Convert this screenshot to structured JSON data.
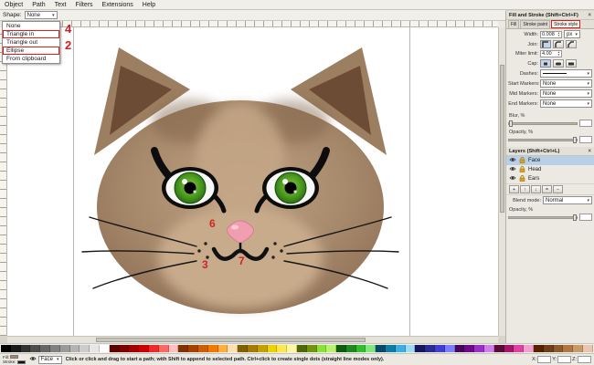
{
  "menu": {
    "items": [
      "Object",
      "Path",
      "Text",
      "Filters",
      "Extensions",
      "Help"
    ]
  },
  "toolbar": {
    "shape_label": "Shape:",
    "shape_value": "None"
  },
  "shape_menu": {
    "items": [
      {
        "label": "None",
        "boxed": false,
        "annotation": ""
      },
      {
        "label": "Triangle in",
        "boxed": true,
        "annotation": "4"
      },
      {
        "label": "Triangle out",
        "boxed": false,
        "annotation": ""
      },
      {
        "label": "Ellipse",
        "boxed": true,
        "annotation": "2"
      },
      {
        "label": "From clipboard",
        "boxed": false,
        "annotation": ""
      }
    ]
  },
  "canvas_annotations": {
    "nose_number": "6",
    "mouth_left_number": "3",
    "mouth_right_number": "7"
  },
  "artwork": {
    "subject": "cat face drawing",
    "fur_color": "#a5876a",
    "ear_inner_color": "#6d4c35",
    "muzzle_color": "#c8ab8b",
    "eye_iris_color": "#46961e",
    "nose_color": "#ef9fb0",
    "outline_color": "#111111"
  },
  "fill_stroke_panel": {
    "title": "Fill and Stroke (Shift+Ctrl+F)",
    "tabs": [
      {
        "label": "Fill"
      },
      {
        "label": "Stroke paint"
      },
      {
        "label": "Stroke style"
      }
    ],
    "active_tab": "Stroke style",
    "width_label": "Width:",
    "width_value": "0.008",
    "width_unit": "px",
    "join_label": "Join:",
    "miter_label": "Miter limit:",
    "miter_value": "4.00",
    "cap_label": "Cap:",
    "dashes_label": "Dashes:",
    "markers": [
      {
        "label": "Start Markers:",
        "value": "None"
      },
      {
        "label": "Mid Markers:",
        "value": "None"
      },
      {
        "label": "End Markers:",
        "value": "None"
      }
    ],
    "blur_label": "Blur, %",
    "opacity_label": "Opacity, %"
  },
  "layers_panel": {
    "title": "Layers (Shift+Ctrl+L)",
    "layers": [
      {
        "name": "Face",
        "visible": true,
        "locked": true
      },
      {
        "name": "Head",
        "visible": true,
        "locked": true
      },
      {
        "name": "Ears",
        "visible": true,
        "locked": true
      }
    ],
    "selected_layer": "Face",
    "blend_label": "Blend mode:",
    "blend_value": "Normal",
    "opacity_label": "Opacity, %"
  },
  "status_bar": {
    "fill_label": "Fill:",
    "stroke_label": "Stroke:",
    "layer_name": "Face",
    "message": "Click or click and drag to start a path; with Shift to append to selected path. Ctrl+click to create single dots (straight line modes only).",
    "x_label": "X:",
    "y_label": "Y:",
    "z_label": "Z:"
  },
  "palette": {
    "colors": [
      "#000000",
      "#1a1a1a",
      "#333333",
      "#4d4d4d",
      "#666666",
      "#808080",
      "#999999",
      "#b3b3b3",
      "#cccccc",
      "#e6e6e6",
      "#ffffff",
      "#5c0000",
      "#800000",
      "#a40000",
      "#cc0000",
      "#ef2929",
      "#ff6666",
      "#ffc0c0",
      "#803300",
      "#a64200",
      "#ce5c00",
      "#f57900",
      "#fcaf3e",
      "#ffe0b0",
      "#806000",
      "#a67c00",
      "#c4a000",
      "#edd400",
      "#fce94f",
      "#fff7a0",
      "#4e6a06",
      "#73940f",
      "#8ae234",
      "#b8f26e",
      "#0e5c0e",
      "#1e8a1e",
      "#2fbf2f",
      "#7fe87f",
      "#064a6a",
      "#0a7ea4",
      "#3caee0",
      "#9adcf2",
      "#16165e",
      "#2a2a9a",
      "#3f3fd4",
      "#7d7dff",
      "#46065c",
      "#6d0a8a",
      "#9b30c4",
      "#cf7fe8",
      "#5c0a3a",
      "#a4146a",
      "#e040a0",
      "#f2a0ce",
      "#552200",
      "#6e3d1b",
      "#8f5a2a",
      "#b07840",
      "#c89a6a",
      "#e9c6af"
    ]
  }
}
